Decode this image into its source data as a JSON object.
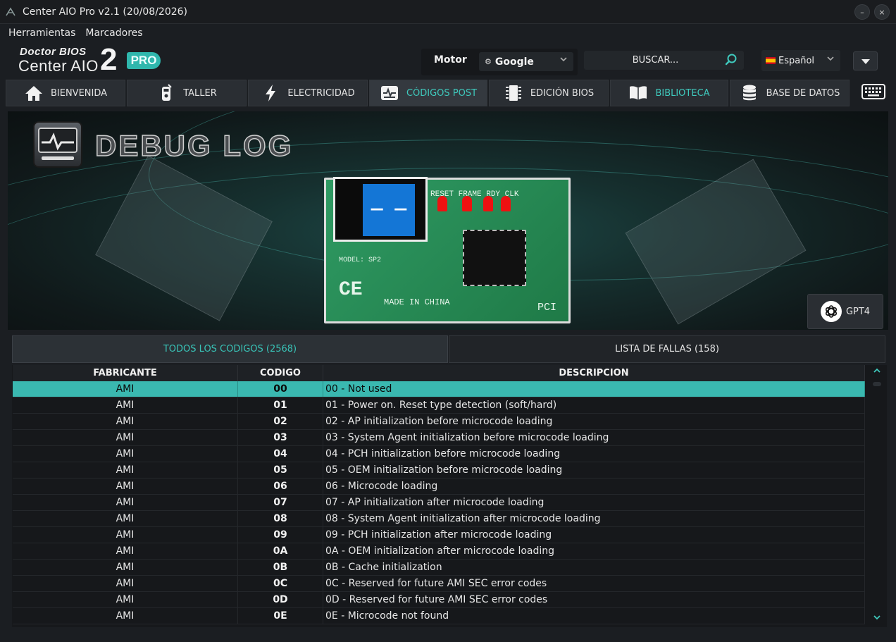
{
  "window": {
    "title": "Center AIO Pro v2.1 (20/08/2026)",
    "minimize_label": "–",
    "close_label": "×"
  },
  "menu": {
    "items": [
      "Herramientas",
      "Marcadores"
    ]
  },
  "header": {
    "logo_line1": "Doctor BIOS",
    "logo_line2": "Center AIO",
    "logo_number": "2",
    "logo_badge": "PRO",
    "motor_label": "Motor",
    "motor_value": "Google",
    "search_placeholder": "BUSCAR...",
    "language_value": "Español"
  },
  "tabs": [
    {
      "label": "BIENVENIDA",
      "icon": "home-icon"
    },
    {
      "label": "TALLER",
      "icon": "multimeter-icon"
    },
    {
      "label": "ELECTRICIDAD",
      "icon": "lightning-icon"
    },
    {
      "label": "CÓDIGOS POST",
      "icon": "post-card-icon"
    },
    {
      "label": "EDICIÓN BIOS",
      "icon": "chip-icon"
    },
    {
      "label": "BIBLIOTECA",
      "icon": "book-icon"
    },
    {
      "label": "BASE DE DATOS",
      "icon": "database-icon"
    }
  ],
  "active_tab": "CÓDIGOS POST",
  "banner": {
    "title": "DEBUG LOG",
    "lcd_display": "— —",
    "pcb_model": "MODEL: SP2",
    "pcb_made_in": "MADE IN CHINA",
    "pcb_labels": "RESET FRAME RDY CLK",
    "pcb_ce": "CE",
    "pcb_pci": "PCI",
    "gpt_button_label": "GPT4"
  },
  "subtabs": [
    {
      "label": "TODOS LOS CODIGOS (2568)"
    },
    {
      "label": "LISTA DE FALLAS (158)"
    }
  ],
  "table": {
    "columns": [
      "FABRICANTE",
      "CODIGO",
      "DESCRIPCION"
    ],
    "rows": [
      {
        "fabricante": "AMI",
        "codigo": "00",
        "descripcion": "00 - Not used"
      },
      {
        "fabricante": "AMI",
        "codigo": "01",
        "descripcion": "01 - Power on. Reset type detection (soft/hard)"
      },
      {
        "fabricante": "AMI",
        "codigo": "02",
        "descripcion": "02 - AP initialization before microcode loading"
      },
      {
        "fabricante": "AMI",
        "codigo": "03",
        "descripcion": "03 - System Agent initialization before microcode loading"
      },
      {
        "fabricante": "AMI",
        "codigo": "04",
        "descripcion": "04 - PCH initialization before microcode loading"
      },
      {
        "fabricante": "AMI",
        "codigo": "05",
        "descripcion": "05 - OEM initialization before microcode loading"
      },
      {
        "fabricante": "AMI",
        "codigo": "06",
        "descripcion": "06 - Microcode loading"
      },
      {
        "fabricante": "AMI",
        "codigo": "07",
        "descripcion": "07 - AP initialization after microcode loading"
      },
      {
        "fabricante": "AMI",
        "codigo": "08",
        "descripcion": "08 - System Agent initialization after microcode loading"
      },
      {
        "fabricante": "AMI",
        "codigo": "09",
        "descripcion": "09 - PCH initialization after microcode loading"
      },
      {
        "fabricante": "AMI",
        "codigo": "0A",
        "descripcion": "0A - OEM initialization after microcode loading"
      },
      {
        "fabricante": "AMI",
        "codigo": "0B",
        "descripcion": "0B - Cache initialization"
      },
      {
        "fabricante": "AMI",
        "codigo": "0C",
        "descripcion": "0C - Reserved for future AMI SEC error codes"
      },
      {
        "fabricante": "AMI",
        "codigo": "0D",
        "descripcion": "0D - Reserved for future AMI SEC error codes"
      },
      {
        "fabricante": "AMI",
        "codigo": "0E",
        "descripcion": "0E - Microcode not found"
      }
    ],
    "selected_row": 0
  },
  "colors": {
    "accent": "#3ab8b0",
    "background": "#1b1e22",
    "tab": "#2a2e33"
  }
}
